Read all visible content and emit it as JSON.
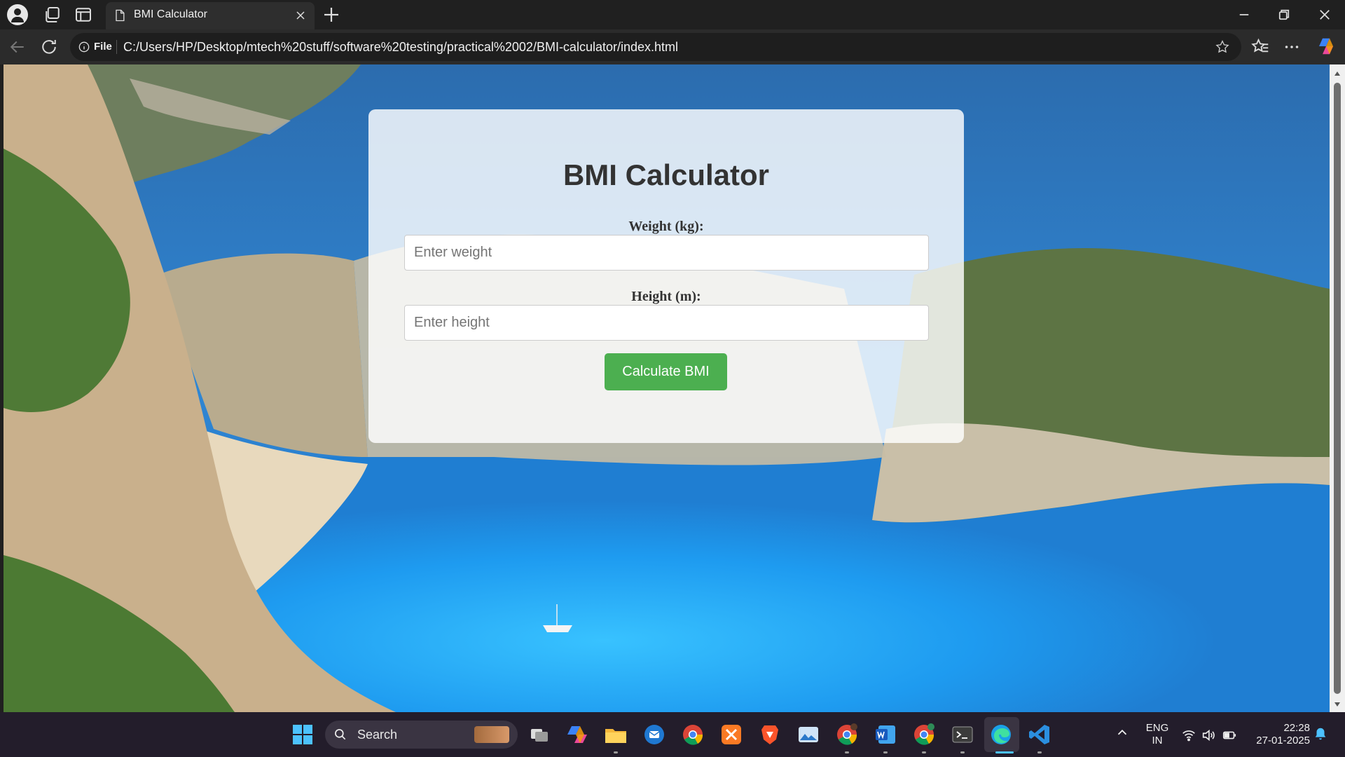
{
  "browser": {
    "tab_title": "BMI Calculator",
    "address_scheme_label": "File",
    "url": "C:/Users/HP/Desktop/mtech%20stuff/software%20testing/practical%2002/BMI-calculator/index.html"
  },
  "page": {
    "title": "BMI Calculator",
    "weight_label": "Weight (kg):",
    "weight_placeholder": "Enter weight",
    "height_label": "Height (m):",
    "height_placeholder": "Enter height",
    "calculate_button": "Calculate BMI",
    "accent_color": "#4caf50"
  },
  "taskbar": {
    "search_placeholder": "Search",
    "language": "ENG",
    "region": "IN",
    "time": "22:28",
    "date": "27-01-2025",
    "pinned_apps": [
      "windows-start-icon",
      "search-icon",
      "task-view-icon",
      "copilot-icon",
      "file-explorer-icon",
      "thunderbird-icon",
      "chrome-icon",
      "xampp-icon",
      "brave-icon",
      "photos-icon",
      "chrome-profile-icon",
      "word-icon",
      "chrome-profile-2-icon",
      "terminal-icon",
      "edge-icon",
      "vscode-icon"
    ]
  }
}
